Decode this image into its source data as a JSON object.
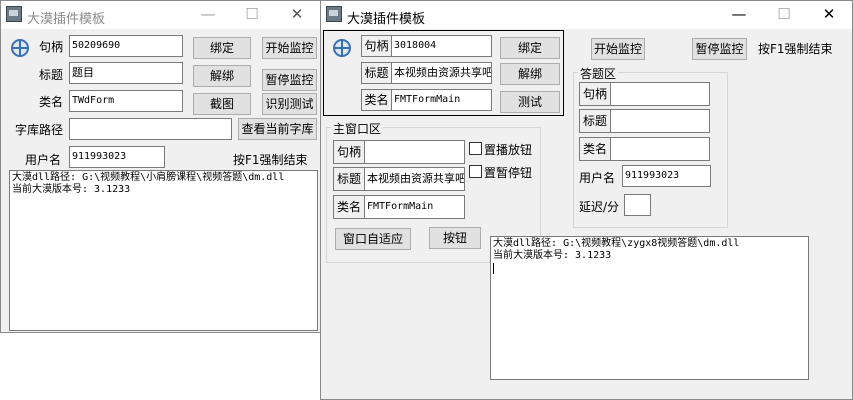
{
  "window1": {
    "title": "大漠插件模板",
    "handle_label": "句柄",
    "handle_value": "50209690",
    "title_label": "标题",
    "title_value": "题目",
    "class_label": "类名",
    "class_value": "TWdForm",
    "buttons": {
      "bind": "绑定",
      "unbind": "解绑",
      "screenshot": "截图",
      "start_monitor": "开始监控",
      "pause_monitor": "暂停监控",
      "recognize_test": "识别测试",
      "view_dict": "查看当前字库"
    },
    "dict_path_label": "字库路径",
    "dict_path_value": "",
    "username_label": "用户名",
    "username_value": "911993023",
    "f1_hint": "按F1强制结束",
    "log_lines": [
      "大漠dll路径: G:\\视频教程\\小肩膀课程\\视频答题\\dm.dll",
      "当前大漠版本号: 3.1233"
    ]
  },
  "window2": {
    "title": "大漠插件模板",
    "handle_label": "句柄",
    "handle_value": "3018004",
    "title_label": "标题",
    "title_value": "本视频由资源共享吧",
    "class_label": "类名",
    "class_value": "FMTFormMain",
    "buttons": {
      "bind": "绑定",
      "unbind": "解绑",
      "test": "测试",
      "start_monitor": "开始监控",
      "pause_monitor": "暂停监控",
      "window_adapt": "窗口自适应",
      "button": "按钮"
    },
    "f1_hint": "按F1强制结束",
    "main_group": {
      "title": "主窗口区",
      "handle_label": "句柄",
      "handle_value": "",
      "title_label": "标题",
      "title_value": "本视频由资源共享吧",
      "class_label": "类名",
      "class_value": "FMTFormMain",
      "chk_play": "置播放钮",
      "chk_pause": "置暂停钮"
    },
    "answer_group": {
      "title": "答题区",
      "handle_label": "句柄",
      "title_label": "标题",
      "class_label": "类名",
      "username_label": "用户名",
      "username_value": "911993023",
      "delay_label": "延迟/分",
      "delay_value": ""
    },
    "log_lines": [
      "大漠dll路径: G:\\视频教程\\zygx8视频答题\\dm.dll",
      "当前大漠版本号: 3.1233"
    ]
  }
}
